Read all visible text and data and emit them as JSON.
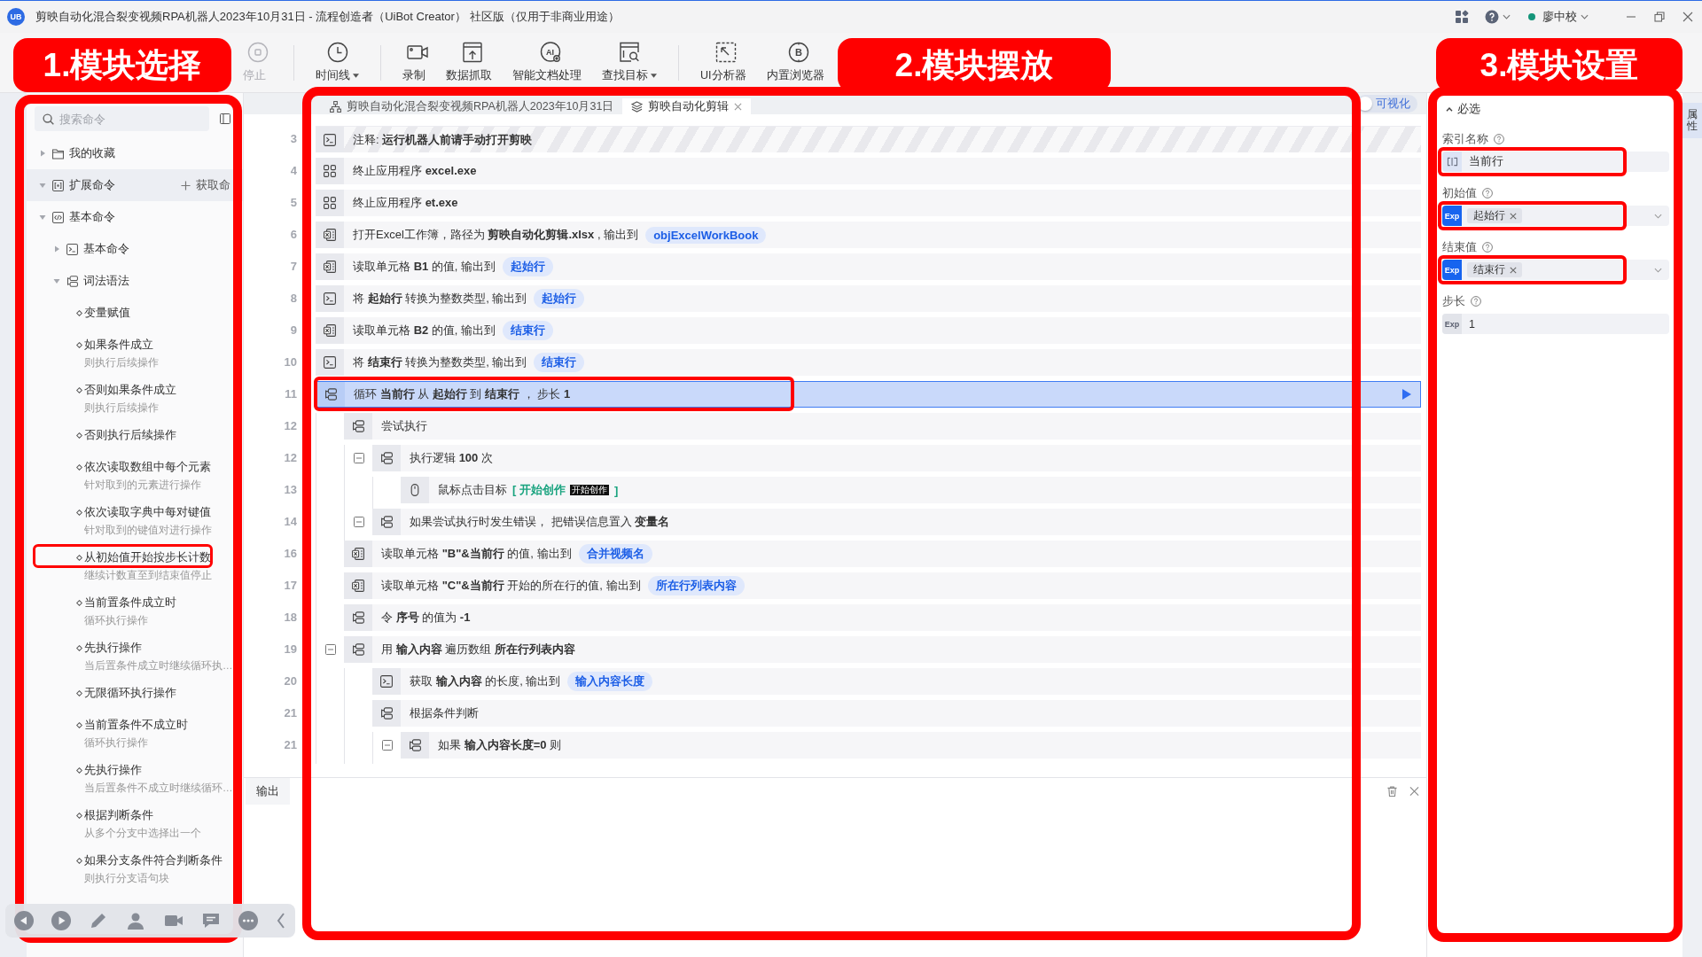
{
  "window": {
    "logo_text": "UB",
    "title": "剪映自动化混合裂变视频RPA机器人2023年10月31日 - 流程创造者（UiBot Creator） 社区版（仅用于非商业用途）",
    "user": "廖中校"
  },
  "toolbar": {
    "groups": [
      {
        "buttons": [
          {
            "kind": "stop",
            "label": "停止",
            "disabled": true,
            "dropdown": false
          }
        ]
      },
      {
        "buttons": [
          {
            "kind": "clock",
            "label": "时间线",
            "disabled": false,
            "dropdown": true
          }
        ]
      },
      {
        "buttons": [
          {
            "kind": "record",
            "label": "录制",
            "disabled": false,
            "dropdown": false
          },
          {
            "kind": "scrape",
            "label": "数据抓取",
            "disabled": false,
            "dropdown": false
          },
          {
            "kind": "ai",
            "label": "智能文档处理",
            "icon_text": "AI",
            "disabled": false,
            "dropdown": false
          },
          {
            "kind": "find",
            "label": "查找目标",
            "disabled": false,
            "dropdown": true
          }
        ]
      },
      {
        "buttons": [
          {
            "kind": "inspect",
            "label": "UI分析器",
            "disabled": false,
            "dropdown": false
          },
          {
            "kind": "browser",
            "label": "内置浏览器",
            "icon_text": "B",
            "disabled": false,
            "dropdown": false
          }
        ]
      }
    ]
  },
  "annotations": [
    {
      "kind": "commands",
      "label": "1.模块选择"
    },
    {
      "kind": "editor",
      "label": "2.模块摆放"
    },
    {
      "kind": "properties",
      "label": "3.模块设置"
    }
  ],
  "commands": {
    "search": {
      "placeholder": "搜索命令"
    },
    "tree": [
      {
        "kind": "folder",
        "label": "我的收藏",
        "expanded": false,
        "selected": false
      },
      {
        "kind": "extension",
        "label": "扩展命令",
        "expanded": true,
        "selected": true,
        "action": "获取命"
      },
      {
        "kind": "code",
        "label": "基本命令",
        "expanded": true,
        "selected": false,
        "children": [
          {
            "kind": "terminal",
            "label": "基本命令",
            "expanded": false
          },
          {
            "kind": "flow",
            "label": "词法语法",
            "expanded": true,
            "children": [
              {
                "label": "变量赋值",
                "highlighted": false
              },
              {
                "label": "如果条件成立",
                "description": "则执行后续操作",
                "highlighted": false
              },
              {
                "label": "否则如果条件成立",
                "description": "则执行后续操作",
                "highlighted": false
              },
              {
                "label": "否则执行后续操作",
                "highlighted": false
              },
              {
                "label": "依次读取数组中每个元素",
                "description": "针对取到的元素进行操作",
                "highlighted": false
              },
              {
                "label": "依次读取字典中每对键值",
                "description": "针对取到的键值对进行操作",
                "highlighted": false
              },
              {
                "label": "从初始值开始按步长计数",
                "description": "继续计数直至到结束值停止",
                "highlighted": true
              },
              {
                "label": "当前置条件成立时",
                "description": "循环执行操作",
                "highlighted": false
              },
              {
                "label": "先执行操作",
                "description": "当后置条件成立时继续循环执…",
                "highlighted": false
              },
              {
                "label": "无限循环执行操作",
                "highlighted": false
              },
              {
                "label": "当前置条件不成立时",
                "description": "循环执行操作",
                "highlighted": false
              },
              {
                "label": "先执行操作",
                "description": "当后置条件不成立时继续循环…",
                "highlighted": false
              },
              {
                "label": "根据判断条件",
                "description": "从多个分支中选择出一个",
                "highlighted": false
              },
              {
                "label": "如果分支条件符合判断条件",
                "description": "则执行分支语句块",
                "highlighted": false
              }
            ]
          }
        ]
      }
    ]
  },
  "editor": {
    "tabs": [
      {
        "kind": "flowchart",
        "label": "剪映自动化混合裂变视频RPA机器人2023年10月31日",
        "selected": false,
        "closable": false
      },
      {
        "kind": "block",
        "label": "剪映自动化剪辑",
        "selected": true,
        "closable": true
      }
    ],
    "visual_toggle": {
      "label": "可视化",
      "on": false
    },
    "lines": [
      {
        "number": "3",
        "kind": "terminal",
        "text": "注释: **运行机器人前请手动打开剪映**",
        "comment": true,
        "selected": false,
        "highlighted": false
      },
      {
        "number": "4",
        "kind": "app",
        "text": "终止应用程序 **excel.exe**",
        "comment": false,
        "selected": false,
        "highlighted": false
      },
      {
        "number": "5",
        "kind": "app",
        "text": "终止应用程序 **et.exe**",
        "comment": false,
        "selected": false,
        "highlighted": false
      },
      {
        "number": "6",
        "kind": "excel",
        "text": "打开Excel工作簿，路径为 **剪映自动化剪辑.xlsx** , 输出到",
        "output": "objExcelWorkBook",
        "comment": false,
        "selected": false,
        "highlighted": false
      },
      {
        "number": "7",
        "kind": "excel",
        "text": "读取单元格 **B1** 的值, 输出到",
        "output": "起始行",
        "comment": false,
        "selected": false,
        "highlighted": false
      },
      {
        "number": "8",
        "kind": "terminal",
        "text": "将 **起始行** 转换为整数类型, 输出到",
        "output": "起始行",
        "comment": false,
        "selected": false,
        "highlighted": false
      },
      {
        "number": "9",
        "kind": "excel",
        "text": "读取单元格 **B2** 的值, 输出到",
        "output": "结束行",
        "comment": false,
        "selected": false,
        "highlighted": false
      },
      {
        "number": "10",
        "kind": "terminal",
        "text": "将 **结束行** 转换为整数类型, 输出到",
        "output": "结束行",
        "comment": false,
        "selected": false,
        "highlighted": false
      },
      {
        "number": "11",
        "kind": "flow",
        "text": "循环 **当前行** 从 **起始行** 到 **结束行** ， 步长 **1**",
        "comment": false,
        "selected": true,
        "highlighted": true,
        "children": [
          {
            "number": "12",
            "kind": "flow",
            "text": "尝试执行",
            "comment": false,
            "selected": false,
            "highlighted": false,
            "children": [
              {
                "number": "12",
                "kind": "flow",
                "text": "执行逻辑 **100** 次",
                "expanded": true,
                "comment": false,
                "selected": false,
                "highlighted": false,
                "children": [
                  {
                    "number": "13",
                    "kind": "mouse",
                    "text": "鼠标点击目标",
                    "target": {
                      "label": "[ 开始创作",
                      "thumbnail": "开始创作",
                      "end": "]"
                    },
                    "comment": false,
                    "selected": false,
                    "highlighted": false
                  }
                ]
              },
              {
                "number": "14",
                "kind": "flow",
                "text": "如果尝试执行时发生错误， 把错误信息置入 **变量名**",
                "expanded": true,
                "comment": false,
                "selected": false,
                "highlighted": false
              }
            ]
          },
          {
            "number": "16",
            "kind": "excel",
            "text": "读取单元格 **\"B\"&当前行** 的值, 输出到",
            "output": "合并视频名",
            "comment": false,
            "selected": false,
            "highlighted": false
          },
          {
            "number": "17",
            "kind": "excel",
            "text": "读取单元格 **\"C\"&当前行** 开始的所在行的值, 输出到",
            "output": "所在行列表内容",
            "comment": false,
            "selected": false,
            "highlighted": false
          },
          {
            "number": "18",
            "kind": "flow",
            "text": "令 **序号** 的值为 **-1**",
            "comment": false,
            "selected": false,
            "highlighted": false
          },
          {
            "number": "19",
            "kind": "flow",
            "text": "用 **输入内容** 遍历数组 **所在行列表内容**",
            "expanded": true,
            "comment": false,
            "selected": false,
            "highlighted": false,
            "children": [
              {
                "number": "20",
                "kind": "terminal",
                "text": "获取 **输入内容** 的长度, 输出到",
                "output": "输入内容长度",
                "comment": false,
                "selected": false,
                "highlighted": false
              },
              {
                "number": "21",
                "kind": "flow",
                "text": "根据条件判断",
                "comment": false,
                "selected": false,
                "highlighted": false,
                "children": [
                  {
                    "number": "21",
                    "kind": "flow",
                    "text": "如果 **输入内容长度=0** 则",
                    "expanded": true,
                    "comment": false,
                    "selected": false,
                    "highlighted": false
                  }
                ]
              }
            ]
          }
        ]
      }
    ],
    "output": {
      "title": "输出"
    }
  },
  "properties": {
    "section": {
      "label": "必选",
      "expanded": true
    },
    "fields": [
      {
        "kind": "variable",
        "label": "索引名称",
        "value": "当前行",
        "dropdown": false,
        "highlighted": true
      },
      {
        "kind": "expression",
        "label": "初始值",
        "badge": "Exp",
        "exp_active": true,
        "chip": "起始行",
        "dropdown": true,
        "highlighted": true
      },
      {
        "kind": "expression",
        "label": "结束值",
        "badge": "Exp",
        "exp_active": true,
        "chip": "结束行",
        "dropdown": true,
        "highlighted": true
      },
      {
        "kind": "expression",
        "label": "步长",
        "badge": "Exp",
        "exp_active": false,
        "value": "1",
        "dropdown": false,
        "highlighted": false
      }
    ]
  },
  "right_dock": {
    "tabs": [
      {
        "label": "属性",
        "selected": true
      }
    ]
  }
}
